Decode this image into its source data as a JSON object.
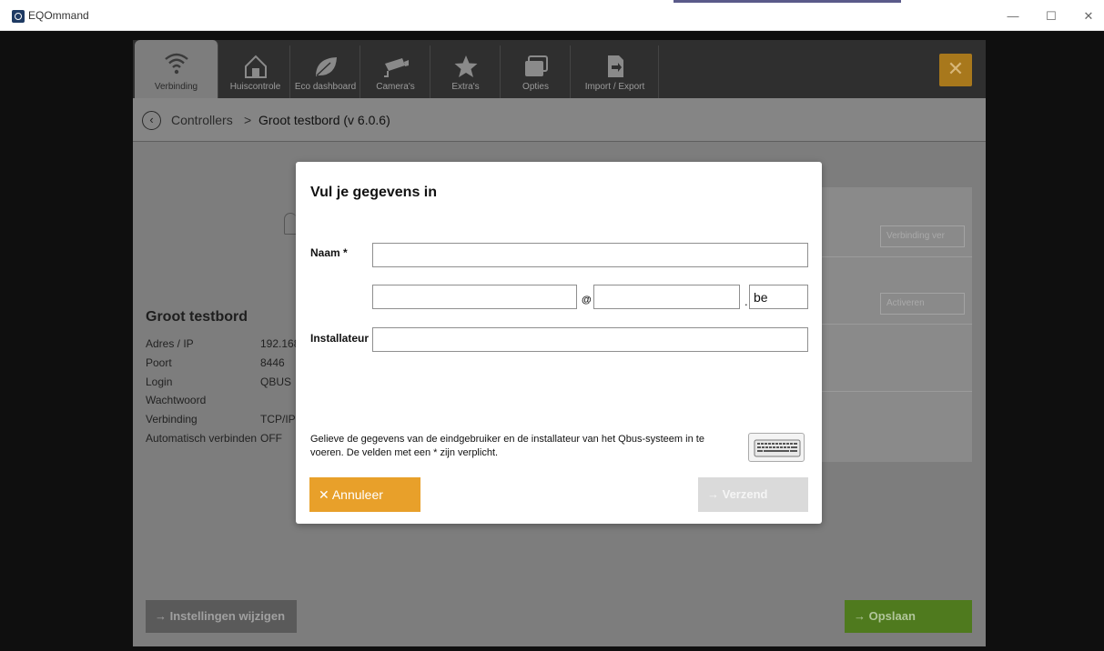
{
  "window": {
    "title": "EQOmmand",
    "minimize": "—",
    "maximize": "☐",
    "close": "✕"
  },
  "tabs": [
    {
      "label": "Verbinding",
      "icon": "wifi-icon",
      "active": true
    },
    {
      "label": "Huiscontrole",
      "icon": "home-icon",
      "active": false
    },
    {
      "label": "Eco dashboard",
      "icon": "leaf-icon",
      "active": false
    },
    {
      "label": "Camera's",
      "icon": "camera-icon",
      "active": false
    },
    {
      "label": "Extra's",
      "icon": "star-icon",
      "active": false
    },
    {
      "label": "Opties",
      "icon": "windows-icon",
      "active": false
    },
    {
      "label": "Import / Export",
      "icon": "import-export-icon",
      "active": false
    }
  ],
  "header": {
    "close_glyph": "✕"
  },
  "breadcrumb": {
    "back_glyph": "‹",
    "root": "Controllers",
    "separator": ">",
    "current": "Groot testbord (v 6.0.6)"
  },
  "controller": {
    "title": "Groot testbord",
    "fields": [
      {
        "label": "Adres / IP",
        "value": "192.168."
      },
      {
        "label": "Poort",
        "value": "8446"
      },
      {
        "label": "Login",
        "value": "QBUS"
      },
      {
        "label": "Wachtwoord",
        "value": ""
      },
      {
        "label": "Verbinding",
        "value": "TCP/IP"
      },
      {
        "label": "Automatisch verbinden",
        "value": "OFF"
      }
    ]
  },
  "right_panel": {
    "connect_label": "Verbinding ver",
    "activate_label": "Activeren"
  },
  "bottom": {
    "change_label": "→  Instellingen wijzigen",
    "save_label": "→  Opslaan"
  },
  "modal": {
    "title": "Vul je gegevens in",
    "name_label": "Naam *",
    "name_value": "",
    "email_user_value": "",
    "at_symbol": "@",
    "email_domain_value": "",
    "dot_symbol": ".",
    "email_tld_value": "be",
    "installer_label": "Installateur",
    "installer_value": "",
    "hint": "Gelieve de gegevens van de eindgebruiker en de installateur van het Qbus-systeem in te voeren. De velden met een * zijn verplicht.",
    "cancel_label": "✕  Annuleer",
    "send_label": "→  Verzend"
  },
  "colors": {
    "accent_orange": "#e8a02a",
    "save_green": "#4f7a1e",
    "tabbar": "#2f2f2f"
  }
}
